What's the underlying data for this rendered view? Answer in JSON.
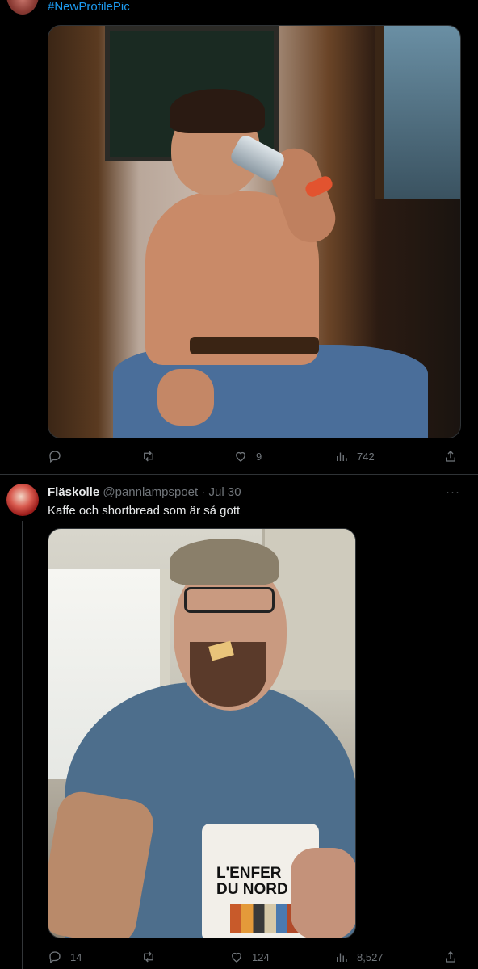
{
  "tweets": [
    {
      "hashtag": "#NewProfilePic",
      "actions": {
        "replies": "",
        "retweets": "",
        "likes": "9",
        "views": "742"
      }
    },
    {
      "name": "Fläskolle",
      "handle": "@pannlampspoet",
      "separator": "·",
      "date": "Jul 30",
      "text": "Kaffe och shortbread som är så gott",
      "more": "···",
      "mug_text_line1": "L'ENFER",
      "mug_text_line2": "DU NORD",
      "actions": {
        "replies": "14",
        "retweets": "",
        "likes": "124",
        "views": "8,527"
      }
    }
  ],
  "icons": {
    "reply": "reply-icon",
    "retweet": "retweet-icon",
    "like": "heart-icon",
    "views": "views-icon",
    "share": "share-icon",
    "more": "more-icon"
  },
  "colors": {
    "background": "#000000",
    "text": "#e7e9ea",
    "muted": "#71767b",
    "link": "#1d9bf0",
    "border": "#2f3336"
  }
}
